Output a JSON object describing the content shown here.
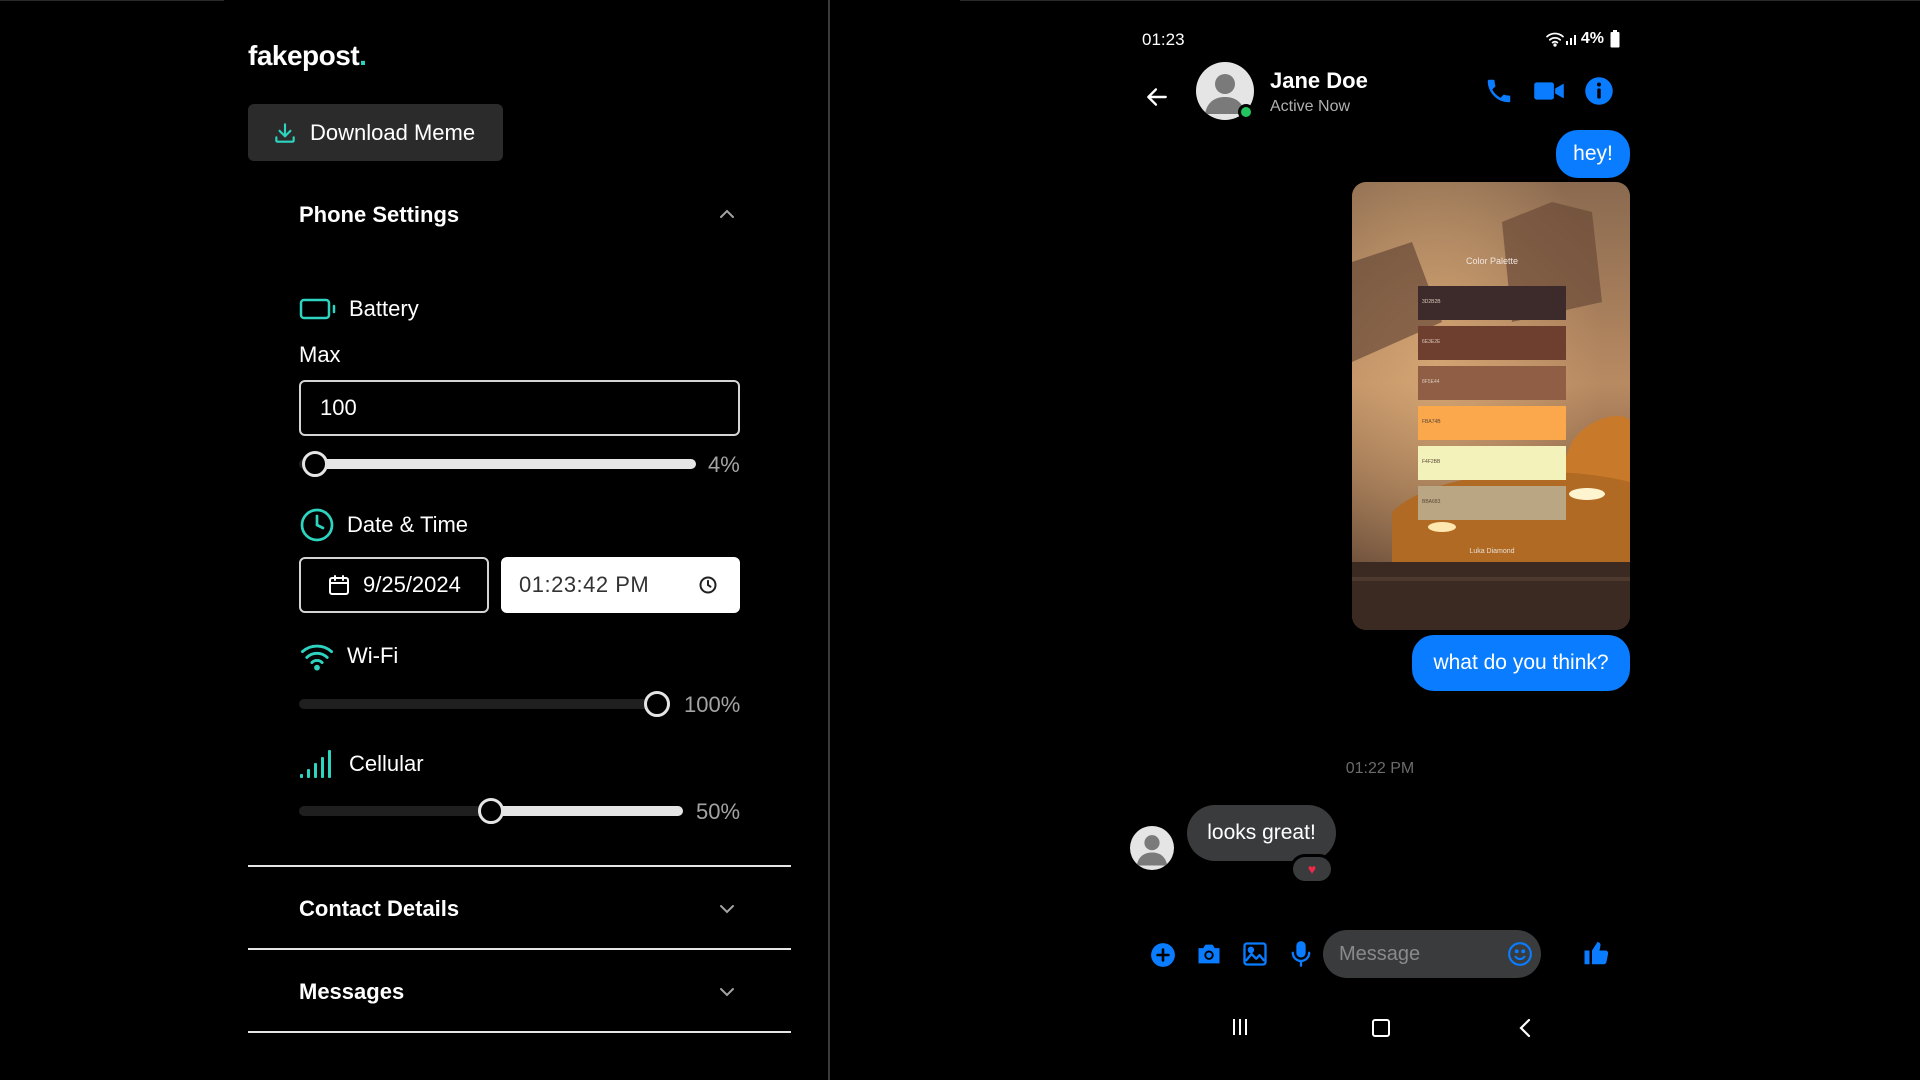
{
  "app": {
    "logo_text": "fakepost",
    "logo_dot": ".",
    "download_label": "Download Meme"
  },
  "phone_settings": {
    "title": "Phone Settings",
    "expanded": true,
    "battery": {
      "label": "Battery",
      "max_label": "Max",
      "max_value": "100",
      "level_percent": 4,
      "level_text": "4%"
    },
    "datetime": {
      "label": "Date & Time",
      "date": "9/25/2024",
      "time": "01:23:42 PM"
    },
    "wifi": {
      "label": "Wi-Fi",
      "level_percent": 100,
      "level_text": "100%"
    },
    "cellular": {
      "label": "Cellular",
      "level_percent": 50,
      "level_text": "50%"
    }
  },
  "sections": {
    "contact_details": "Contact Details",
    "messages": "Messages"
  },
  "phone": {
    "status_time": "01:23",
    "battery_text": "4%",
    "contact_name": "Jane Doe",
    "contact_status": "Active Now",
    "messages": {
      "out_1": "hey!",
      "image_caption": "Color Palette",
      "image_footer": "Luka Diamond",
      "out_2": "what do you think?",
      "timestamp": "01:22 PM",
      "in_1": "looks great!",
      "reaction": "♥"
    },
    "composer_placeholder": "Message"
  },
  "palette": [
    {
      "label": "3D2B2B",
      "color": "#3d2b2b"
    },
    {
      "label": "6E3E2E",
      "color": "#6e3e2e"
    },
    {
      "label": "8F5E44",
      "color": "#8f5e44"
    },
    {
      "label": "FBA74B",
      "color": "#fba74b"
    },
    {
      "label": "F4F2BB",
      "color": "#f4f2bb"
    },
    {
      "label": "BBA683",
      "color": "#bba683"
    }
  ],
  "colors": {
    "accent": "#2dd4bf",
    "messenger_blue": "#0a7cff",
    "incoming_bubble": "#3a3b3c",
    "online": "#22c55e"
  }
}
